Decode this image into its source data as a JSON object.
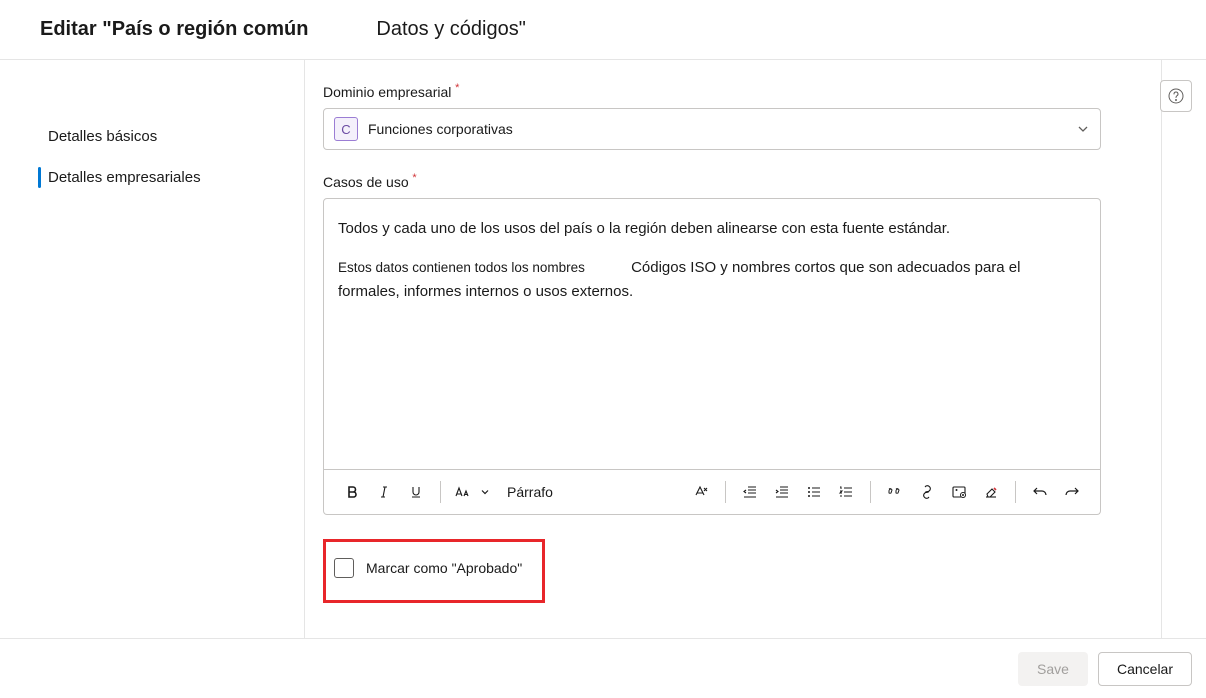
{
  "header": {
    "title": "Editar \"País o región común",
    "subtitle": "Datos y códigos\""
  },
  "sidebar": {
    "items": [
      {
        "label": "Detalles básicos",
        "active": false
      },
      {
        "label": "Detalles empresariales",
        "active": true
      }
    ]
  },
  "form": {
    "domain": {
      "label": "Dominio empresarial",
      "badge": "C",
      "value": "Funciones corporativas"
    },
    "usecases": {
      "label": "Casos de uso",
      "line1": "Todos y cada uno de los usos del país o la región deben alinearse con esta fuente estándar.",
      "line2a": "Estos datos contienen todos los nombres",
      "line2b": "Códigos ISO y nombres cortos que son adecuados para el",
      "line3": "formales, informes internos o usos externos."
    },
    "toolbar": {
      "paragraph": "Párrafo"
    },
    "approve": {
      "label": "Marcar como \"Aprobado\""
    }
  },
  "footer": {
    "save": "Save",
    "cancel": "Cancelar"
  }
}
